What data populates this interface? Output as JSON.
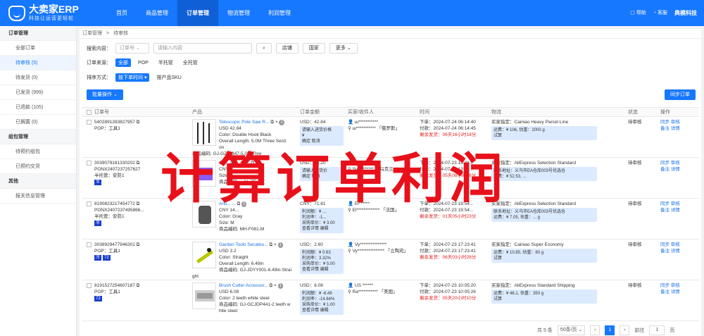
{
  "brand": {
    "title": "大卖家ERP",
    "subtitle": "科技让运营更轻松"
  },
  "nav": [
    "首页",
    "商品管理",
    "订单管理",
    "物流管理",
    "利润管理"
  ],
  "topright": {
    "help": "帮助",
    "service": "客服",
    "company": "典模科技"
  },
  "sidebar": {
    "sec1": "订单管理",
    "items1": [
      "全部订单",
      "待审核 (5)",
      "待发货 (0)",
      "已发货 (999)",
      "已退款 (105)",
      "已搁置 (0)"
    ],
    "sec2": "组包管理",
    "items2": [
      "待预约组包",
      "已预约交货"
    ],
    "sec3": "其他",
    "items3": [
      "报关信息管理"
    ]
  },
  "crumb": [
    "订单管理",
    ">",
    "待审核"
  ],
  "search": {
    "label": "搜索内容：",
    "field": "订单号",
    "placeholder": "请输入内容",
    "store": "店铺",
    "country": "国家",
    "more": "更多"
  },
  "source": {
    "label": "订单来源：",
    "options": [
      "全部",
      "POP",
      "半托管",
      "全托管"
    ]
  },
  "sort": {
    "label": "排序方式：",
    "primary": "按下单时间",
    "secondary": "按产品SKU"
  },
  "toolbar": {
    "batch": "批量操作",
    "sync": "同步订单"
  },
  "columns": [
    "订单号",
    "产品",
    "订单金额",
    "买家/收件人",
    "时间",
    "物流",
    "状态",
    "操作"
  ],
  "rows": [
    {
      "order": "5402891393827957",
      "tag": "POP：工具1",
      "p_title": "Telescopic Pole Saw R...",
      "p_qty": "×",
      "p_qn": "1",
      "p_lines": [
        "USD 42.84",
        "Color: Double Hook Black",
        "Overall Length: 5.0M Three Secti",
        "on",
        "商品编码: GJ-GZJ5347-5.0M Thre",
        "e Section Double Hook Black"
      ],
      "amount": "USD：42.84",
      "amt_box": [
        "请输入进货价格",
        "¥",
        "确定  取消"
      ],
      "buyer": "ш***********",
      "recv": "ш*********** 「俄罗斯」",
      "t1": "下单：2024-07-24 06:14:40",
      "t2": "付款：2024-07-24 06:14:45",
      "t3": "剩余发货：06天16小时18分",
      "logi": "买家指定：Cainiao Heavy Parcel Line",
      "logi_box": [
        "运费：¥ 106,  估重：2000 g",
        "试算"
      ],
      "status": "待审核",
      "ops": [
        "同步  审核",
        "备注  详情"
      ]
    },
    {
      "order": "3039079181330202",
      "order2": "PONX2407237257627",
      "tag": "半托管：安防1",
      "p_title": "Cu... Alm... C...",
      "p_qty": "",
      "p_qn": "5",
      "p_lines": [
        "CNY ...",
        "Size: ...",
        "商品编码: ...AL-7E-F..."
      ],
      "amount": "USD：66.20",
      "amt_box": [
        "请输入进货价",
        "",
        "确定  取消"
      ],
      "buyer": "Sv******",
      "recv": "Sv********* 「乌克兰」",
      "t1": "下单：2024-07-23 13:31:..",
      "t2": "付款：2024-07-23 13:31:..",
      "t3": "剩余发货：05天08小时38分",
      "logi": "买家指定：AliExpress Selection Standard",
      "logi_box": [
        "联系地址：义乌市EA仓库003号优选仓",
        "运费：¥ 52.53,  ..."
      ],
      "status": "待审核",
      "ops": [
        "同步  审核",
        "备注  详情"
      ],
      "pills": [
        "半"
      ]
    },
    {
      "order": "8190823217454772",
      "order2": "PONX2407237495866...",
      "tag": "半托管：安防1",
      "p_title": "Anti... ...",
      "p_qty": "",
      "p_qn": "1",
      "p_lines": [
        "CNY 14...",
        "Color: Gray",
        "Size: M",
        "商品编码: MH-F081-M"
      ],
      "amount": "CNY：71.81",
      "amt_box": [
        "利润额：¥ ...",
        "利润率：-1...",
        "采购单价：¥ 3.00",
        "查看详情  编辑"
      ],
      "buyer": "El******",
      "recv": "El************* 「法国」",
      "t1": "下单：2024-07-23 19:54:..",
      "t2": "付款：2024-07-23 19:54:..",
      "t3": "剩余发货：01天05小时23分",
      "logi": "买家指定：AliExpress Selection Standard",
      "logi_box": [
        "联系地址：义乌市EA仓库003号优选仓",
        "运费：¥ 7.05,  估重：... g"
      ],
      "status": "待审核",
      "ops": [
        "同步  审核",
        "备注  详情"
      ],
      "pills": [
        "半"
      ]
    },
    {
      "order": "3038929477946301",
      "tag": "POP：工具1",
      "p_title": "Garden Tools Secateu...",
      "p_qty": "×",
      "p_qn": "1",
      "p_lines": [
        "USD 3.2",
        "Color: Straight",
        "Overall Length: 6.49in",
        "商品编码: GJ-JDYY001-6.49in-Strai",
        "ght"
      ],
      "amount": "USD：2.60",
      "amt_box": [
        "利润额：¥ 0.63",
        "利润率：3.32%",
        "采购单价：¥ 5.00",
        "查看详情  编辑"
      ],
      "buyer": "Vy***************",
      "recv": "Vy*************** 「立陶宛」",
      "t1": "下单：2024-07-23 17:23:41",
      "t2": "付款：2024-07-23 17:23:41",
      "t3": "剩余发货：06天03小时28分",
      "logi": "买家指定：Cainiao Super Economy",
      "logi_box": [
        "运费：¥ 10.85,  估重：80 g",
        "试算"
      ],
      "status": "待审核",
      "ops": [
        "同步  审核",
        "备注  详情"
      ],
      "pills": [
        "冷",
        "72"
      ]
    },
    {
      "order": "8191527254607187",
      "tag": "POP：工具1",
      "p_title": "Brush Cutter Accessor...",
      "p_qty": "×",
      "p_qn": "1",
      "p_lines": [
        "USD 6.08",
        "Color: 2 teeth white steel",
        "商品编码: GJ-GCJDP441-2 teeth w",
        "hite steel"
      ],
      "amount": "USD：6.08",
      "amt_box": [
        "利润额：¥ -6.49",
        "利润率：-14.64%",
        "采购单价：¥ 1.00",
        "查看详情  编辑"
      ],
      "buyer": "US ******",
      "recv": "Ra*********** 「美国」",
      "t1": "下单：2024-07-23 10:05:20",
      "t2": "付款：2024-07-23 10:05:26",
      "t3": "剩余发货：05天20小时10分",
      "logi": "买家指定：AliExpress Standard Shipping",
      "logi_box": [
        "运费：¥ 46.1,  估重：350 g",
        "试算"
      ],
      "status": "待审核",
      "ops": [
        "同步  审核",
        "备注  详情"
      ],
      "pills": [
        "72"
      ]
    }
  ],
  "pager": {
    "total": "共 5 条",
    "size": "50条/页",
    "page": "1",
    "goto": "前往",
    "goto_val": "1",
    "unit": "页"
  },
  "overlay": "计算订单利润"
}
